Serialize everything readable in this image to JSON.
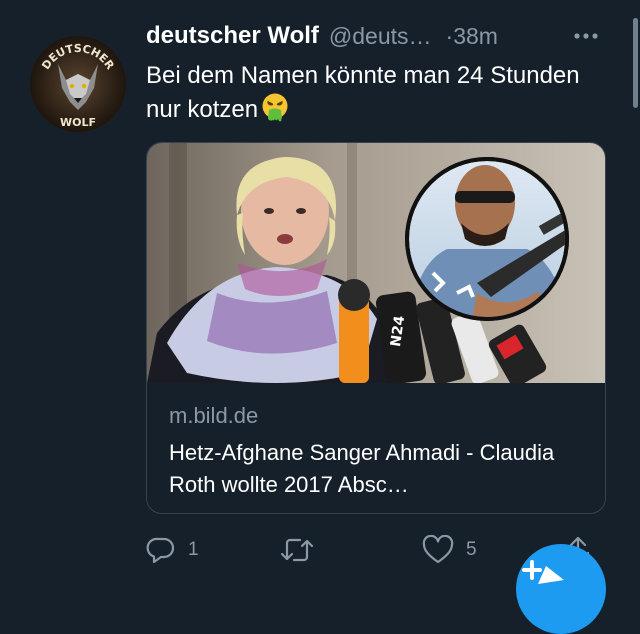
{
  "tweet": {
    "author_name": "deutscher Wolf",
    "handle": "@deuts…",
    "time": "·38m",
    "text": "Bei dem Namen könnte man 24 Stunden nur kotzen",
    "avatar_top_text": "DEUTSCHER",
    "avatar_bottom_text": "WOLF"
  },
  "card": {
    "domain": "m.bild.de",
    "title": "Hetz-Afghane Sanger Ahmadi - Claudia Roth wollte 2017 Absc…"
  },
  "actions": {
    "reply_count": "1",
    "retweet_count": "",
    "like_count": "5"
  },
  "colors": {
    "background": "#15202b",
    "secondary_text": "#8b98a5",
    "border": "#38444d",
    "accent": "#1d9bf0"
  },
  "icons": [
    "more-icon",
    "vomit-emoji-icon",
    "reply-icon",
    "retweet-icon",
    "like-icon",
    "share-icon",
    "compose-icon"
  ]
}
